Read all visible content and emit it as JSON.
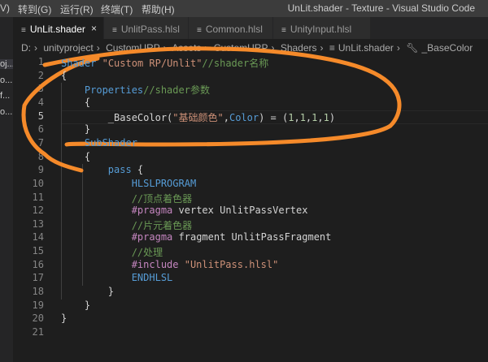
{
  "menu": {
    "items": [
      "V)",
      "转到(G)",
      "运行(R)",
      "终端(T)",
      "帮助(H)"
    ],
    "window_title": "UnLit.shader - Texture - Visual Studio Code"
  },
  "sidebar": {
    "items": [
      "oj...",
      "o...",
      "f...",
      "o..."
    ]
  },
  "tabs": [
    {
      "label": "UnLit.shader",
      "active": true,
      "close": "×"
    },
    {
      "label": "UnlitPass.hlsl"
    },
    {
      "label": "Common.hlsl"
    },
    {
      "label": "UnityInput.hlsl"
    }
  ],
  "breadcrumb": [
    "D:",
    "unityproject",
    "CustomURP",
    "Assets",
    "CustomURP",
    "Shaders",
    "UnLit.shader",
    "_BaseColor"
  ],
  "editor": {
    "current_line": 5,
    "lines": [
      "Shader \"Custom RP/Unlit\"//shader名称",
      "{",
      "    Properties//shader参数",
      "    {",
      "        _BaseColor(\"基础颜色\",Color) = (1,1,1,1)",
      "    }",
      "    SubShader",
      "    {",
      "        pass {",
      "            HLSLPROGRAM",
      "            //顶点着色器",
      "            #pragma vertex UnlitPassVertex",
      "            //片元着色器",
      "            #pragma fragment UnlitPassFragment",
      "            //处理",
      "            #include \"UnlitPass.hlsl\"",
      "            ENDHLSL",
      "        }",
      "    }",
      "}",
      ""
    ]
  },
  "colors": {
    "annotation": "#f58a2a",
    "keyword": "#569cd6",
    "string": "#ce9178",
    "comment": "#6a9955"
  }
}
